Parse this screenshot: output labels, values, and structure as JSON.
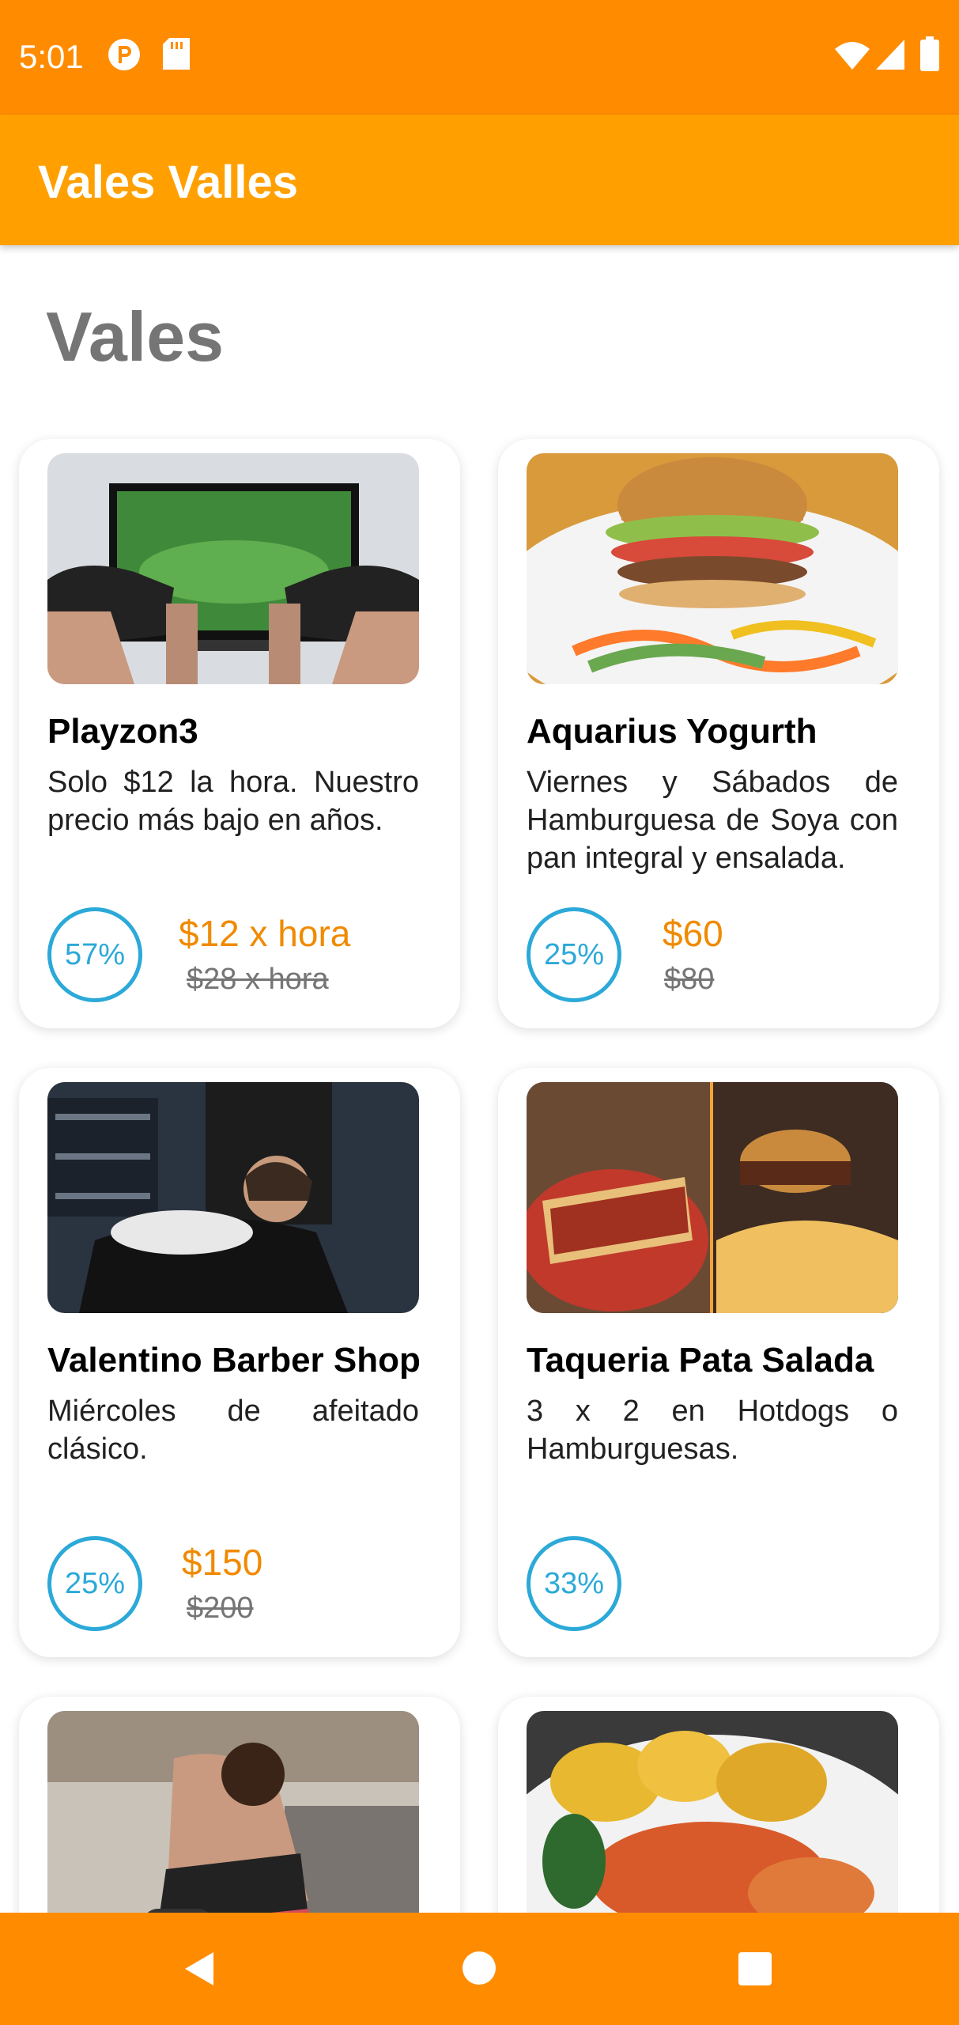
{
  "status_bar": {
    "time": "5:01",
    "icons": [
      "p-notification-icon",
      "sd-card-icon",
      "wifi-icon",
      "signal-icon",
      "battery-icon"
    ]
  },
  "app_bar": {
    "title": "Vales Valles"
  },
  "page": {
    "heading": "Vales"
  },
  "cards": [
    {
      "title": "Playzon3",
      "description": "Solo $12 la hora. Nuestro precio más bajo en años.",
      "discount": "57%",
      "price_new": "$12 x hora",
      "price_old": "$28 x hora"
    },
    {
      "title": "Aquarius Yogurth",
      "description": "Viernes y Sábados de Hamburguesa de Soya con pan integral y ensalada.",
      "discount": "25%",
      "price_new": "$60",
      "price_old": "$80"
    },
    {
      "title": "Valentino Barber Shop",
      "description": "Miércoles de afeitado clásico.",
      "discount": "25%",
      "price_new": "$150",
      "price_old": "$200"
    },
    {
      "title": "Taqueria Pata Salada",
      "description": "3 x 2 en Hotdogs o Hamburguesas.",
      "discount": "33%"
    }
  ],
  "nav_bar": {
    "icons": [
      "back-icon",
      "home-icon",
      "recents-icon"
    ]
  },
  "colors": {
    "status_bar": "#FF8C00",
    "app_bar": "#FFA000",
    "accent_price": "#F08A00",
    "discount_badge": "#2BA9D8"
  }
}
